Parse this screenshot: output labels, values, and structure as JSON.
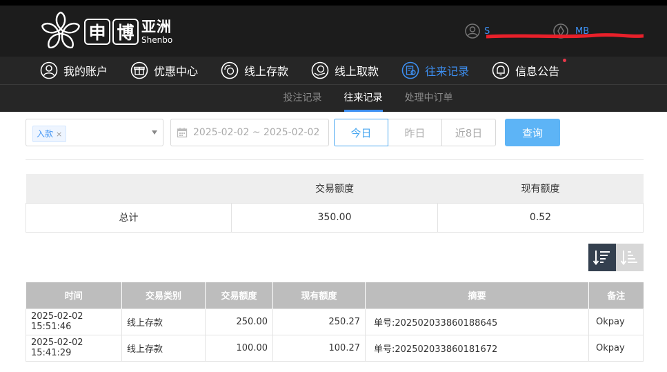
{
  "brand": {
    "char1": "申",
    "char2": "博",
    "cn": "亚洲",
    "en": "Shenbo"
  },
  "user": {
    "name": "S",
    "balance": "MB"
  },
  "nav": [
    {
      "label": "我的账户",
      "icon": "user-circle-icon"
    },
    {
      "label": "优惠中心",
      "icon": "gift-icon"
    },
    {
      "label": "线上存款",
      "icon": "deposit-icon"
    },
    {
      "label": "线上取款",
      "icon": "withdraw-icon"
    },
    {
      "label": "往来记录",
      "icon": "records-icon",
      "active": true
    },
    {
      "label": "信息公告",
      "icon": "bell-icon",
      "badge": true
    }
  ],
  "subnav": [
    {
      "label": "投注记录"
    },
    {
      "label": "往来记录",
      "active": true
    },
    {
      "label": "处理中订单"
    }
  ],
  "filters": {
    "type_tag": "入款",
    "tag_close": "×",
    "date_range": "2025-02-02 ~ 2025-02-02",
    "quick_ranges": [
      "今日",
      "昨日",
      "近8日"
    ],
    "active_range": "今日",
    "query_label": "查询"
  },
  "summary": {
    "headers": [
      "",
      "交易额度",
      "现有额度"
    ],
    "row": [
      "总计",
      "350.00",
      "0.52"
    ]
  },
  "records": {
    "headers": [
      "时间",
      "交易类别",
      "交易额度",
      "现有额度",
      "摘要",
      "备注"
    ],
    "rows": [
      [
        "2025-02-02 15:51:46",
        "线上存款",
        "250.00",
        "250.27",
        "单号:202502033860188645",
        "Okpay"
      ],
      [
        "2025-02-02 15:41:29",
        "线上存款",
        "100.00",
        "100.27",
        "单号:202502033860181672",
        "Okpay"
      ]
    ]
  },
  "colors": {
    "accent": "#3d8ff1",
    "header_bg": "#1c1c1c",
    "nav_bg": "#262626",
    "query_btn": "#5db4f6",
    "badge": "#e8384a",
    "redaction": "#e8202a"
  }
}
